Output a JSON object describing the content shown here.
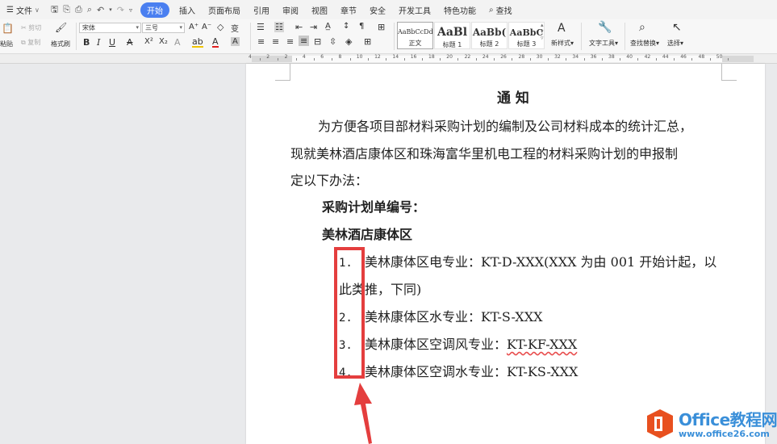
{
  "menubar": {
    "menu_icon": "☰",
    "file": "文件",
    "tabs": [
      "开始",
      "插入",
      "页面布局",
      "引用",
      "审阅",
      "视图",
      "章节",
      "安全",
      "开发工具",
      "特色功能"
    ],
    "active_tab_index": 0,
    "search": "查找"
  },
  "ribbon": {
    "paste": "粘贴",
    "cut": "剪切",
    "copy": "复制",
    "format_painter": "格式刷",
    "font_name": "宋体",
    "font_size": "三号",
    "styles": [
      {
        "preview": "AaBbCcDd",
        "label": "正文"
      },
      {
        "preview": "AaBl",
        "label": "标题 1"
      },
      {
        "preview": "AaBb(",
        "label": "标题 2"
      },
      {
        "preview": "AaBbC",
        "label": "标题 3"
      }
    ],
    "new_style": "新样式",
    "text_tools": "文字工具",
    "find_replace": "查找替换",
    "select": "选择"
  },
  "ruler": {
    "numbers": [
      "4",
      "2",
      "2",
      "4",
      "6",
      "8",
      "10",
      "12",
      "14",
      "16",
      "18",
      "20",
      "22",
      "24",
      "26",
      "28",
      "30",
      "32",
      "34",
      "36",
      "38",
      "40",
      "42",
      "44",
      "46",
      "48",
      "50"
    ]
  },
  "document": {
    "title": "通 知",
    "intro_line1": "为方便各项目部材料采购计划的编制及公司材料成本的统计汇总，",
    "intro_line2": "现就美林酒店康体区和珠海富华里机电工程的材料采购计划的申报制",
    "intro_line3": "定以下办法：",
    "heading1": "采购计划单编号：",
    "heading2": "美林酒店康体区",
    "items": [
      {
        "num": "1.",
        "text": "美林康体区电专业：KT-D-XXX(XXX 为由 001 开始计起，以",
        "cont": "此类推，下同)"
      },
      {
        "num": "2.",
        "text": "美林康体区水专业：KT-S-XXX"
      },
      {
        "num": "3.",
        "text": "美林康体区空调风专业：",
        "code": "KT-KF-XXX"
      },
      {
        "num": "4.",
        "text": "美林康体区空调水专业：KT-KS-XXX"
      }
    ]
  },
  "watermark": {
    "title": "Office教程网",
    "url": "www.office26.com",
    "brand_color": "#e8501f",
    "text_color": "#3a8fd9"
  },
  "colors": {
    "annotation_red": "#e43e3e",
    "active_tab": "#4a7ff0"
  }
}
